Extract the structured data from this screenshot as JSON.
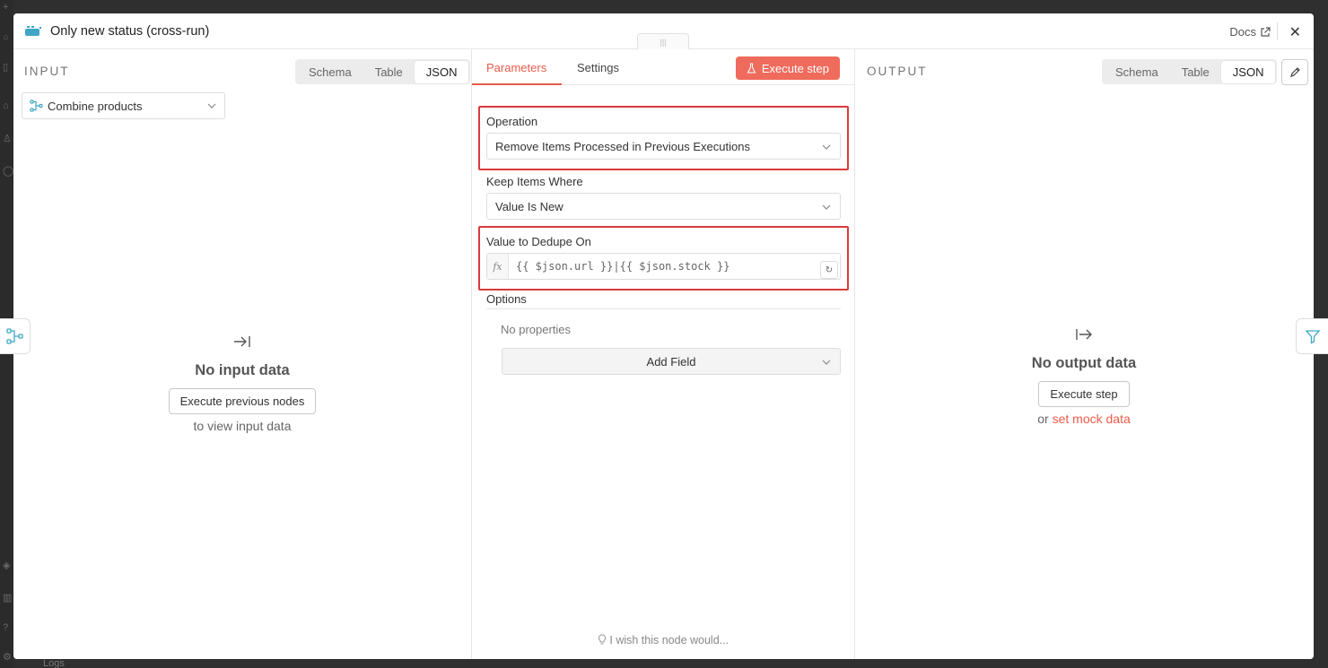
{
  "window": {
    "title": "Only new status (cross-run)",
    "docs_label": "Docs",
    "close_glyph": "✕"
  },
  "input": {
    "label": "INPUT",
    "views": [
      "Schema",
      "Table",
      "JSON"
    ],
    "active_view": "JSON",
    "node_select": "Combine products",
    "empty_title": "No input data",
    "action_button": "Execute previous nodes",
    "helper_text": "to view input data"
  },
  "params": {
    "tabs": [
      "Parameters",
      "Settings"
    ],
    "active_tab": "Parameters",
    "execute_button": "Execute step",
    "operation_label": "Operation",
    "operation_value": "Remove Items Processed in Previous Executions",
    "keep_label": "Keep Items Where",
    "keep_value": "Value Is New",
    "dedupe_label": "Value to Dedupe On",
    "dedupe_fx": "fx",
    "dedupe_value": "{{ $json.url }}|{{ $json.stock }}",
    "options_label": "Options",
    "no_properties": "No properties",
    "add_field": "Add Field",
    "wish_text": "I wish this node would..."
  },
  "output": {
    "label": "OUTPUT",
    "views": [
      "Schema",
      "Table",
      "JSON"
    ],
    "active_view": "JSON",
    "empty_title": "No output data",
    "action_button": "Execute step",
    "helper_prefix": "or",
    "helper_link": "set mock data"
  },
  "background": {
    "logs_label": "Logs"
  },
  "colors": {
    "accent": "#ea5a4a",
    "execute_bg": "#ef6b5c",
    "highlight": "#d93a3a",
    "node_icon": "#3fa6c4"
  },
  "icons": [
    "node-icon",
    "external-link-icon",
    "close-icon",
    "workflow-icon",
    "chevron-down-icon",
    "flask-icon",
    "input-arrow-icon",
    "output-arrow-icon",
    "pencil-icon",
    "filter-icon",
    "lightbulb-icon",
    "expression-reset-icon"
  ]
}
